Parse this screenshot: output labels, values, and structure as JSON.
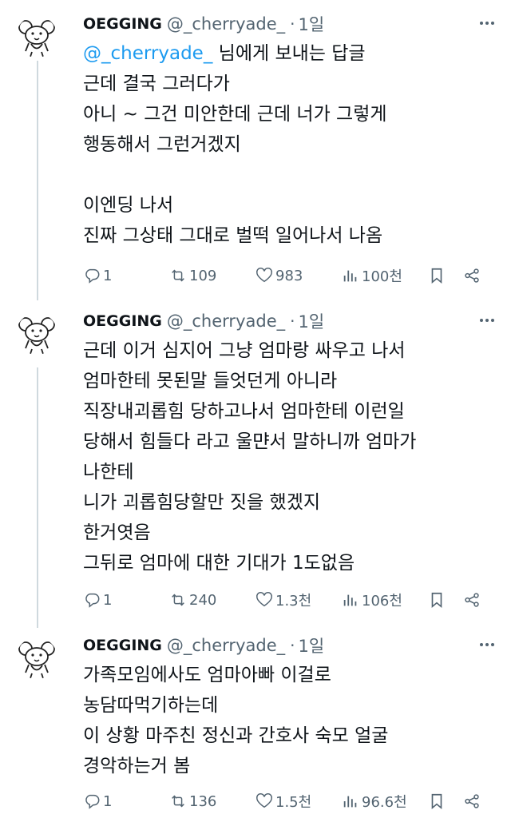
{
  "tweets": [
    {
      "name": "OEGGING",
      "handle": "@_cherryade_",
      "dot": "·",
      "time": "1일",
      "reply_to": {
        "mention": "@_cherryade_",
        "suffix": " 님에게 보내는 답글"
      },
      "lines": [
        "근데 결국 그러다가",
        "아니 ~ 그건 미안한데 근데 너가 그렇게",
        "행동해서 그런거겠지",
        "",
        "이엔딩 나서",
        "진짜 그상태 그대로 벌떡 일어나서 나옴"
      ],
      "stats": {
        "replies": "1",
        "retweets": "109",
        "likes": "983",
        "views": "100천"
      }
    },
    {
      "name": "OEGGING",
      "handle": "@_cherryade_",
      "dot": "·",
      "time": "1일",
      "lines": [
        "근데 이거 심지어 그냥 엄마랑 싸우고 나서",
        "엄마한테 못된말 들엇던게 아니라",
        "직장내괴롭힘 당하고나서 엄마한테 이런일",
        "당해서 힘들다 라고 울먄서 말하니까 엄마가",
        "나한테",
        "니가 괴롭힘당할만 짓을 했겠지",
        "한거엿음",
        "그뒤로 엄마에 대한 기대가 1도없음"
      ],
      "stats": {
        "replies": "1",
        "retweets": "240",
        "likes": "1.3천",
        "views": "106천"
      }
    },
    {
      "name": "OEGGING",
      "handle": "@_cherryade_",
      "dot": "·",
      "time": "1일",
      "lines": [
        "가족모임에사도 엄마아빠 이걸로",
        "농담따먹기하는데",
        "이 상황 마주친 정신과 간호사 숙모 얼굴",
        "경악하는거 봄"
      ],
      "stats": {
        "replies": "1",
        "retweets": "136",
        "likes": "1.5천",
        "views": "96.6천"
      }
    }
  ]
}
